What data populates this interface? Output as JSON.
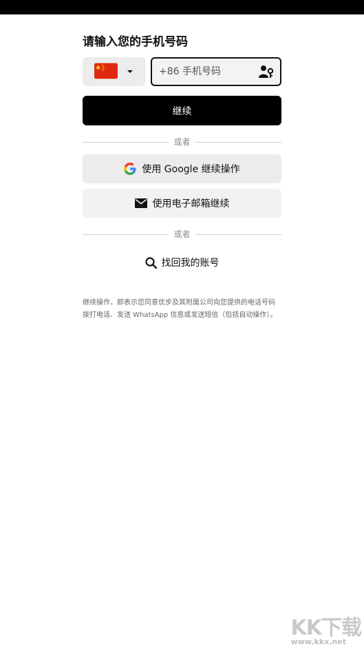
{
  "heading": "请输入您的手机号码",
  "country": {
    "flag_icon": "china-flag-icon",
    "caret_icon": "caret-down-icon"
  },
  "phone": {
    "placeholder": "+86 手机号码",
    "value": "",
    "contact_icon": "contact-key-icon"
  },
  "continue_label": "继续",
  "divider_text": "或者",
  "google_label": "使用 Google 继续操作",
  "email_label": "使用电子邮箱继续",
  "find_account_label": "找回我的账号",
  "legal_text": "继续操作，即表示您同意优步及其附属公司向您提供的电话号码拨打电话、发送 WhatsApp 信息或发送短信（包括自动操作）。",
  "watermark": {
    "logo": "KK下载",
    "url": "www.kkx.net"
  }
}
